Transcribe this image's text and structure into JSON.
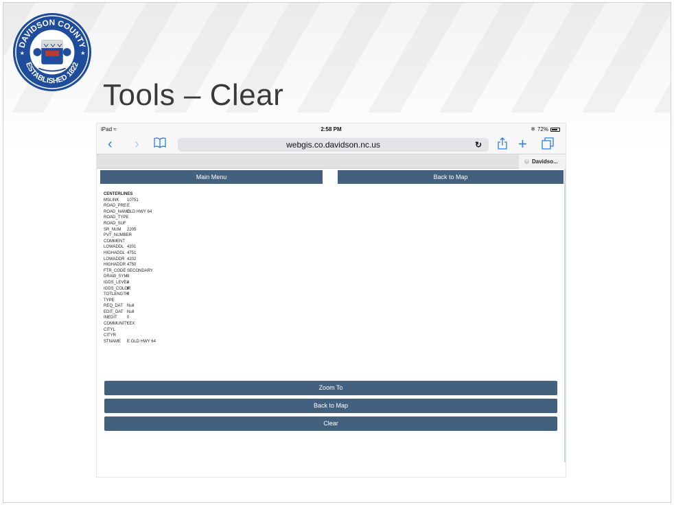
{
  "slide": {
    "title": "Tools – Clear",
    "seal_text_top": "DAVIDSON COUNTY",
    "seal_text_bottom": "ESTABLISHED 1822"
  },
  "status_bar": {
    "device": "iPad",
    "time": "2:58 PM",
    "battery": "72%"
  },
  "browser": {
    "url": "webgis.co.davidson.nc.us",
    "tab_label": "Davidso..."
  },
  "top_buttons": {
    "main_menu": "Main Menu",
    "back_to_map": "Back to Map"
  },
  "attributes": {
    "heading": "CENTERLINES",
    "rows": [
      {
        "key": "MSLINK",
        "value": "10751"
      },
      {
        "key": "ROAD_PRE",
        "value": "E"
      },
      {
        "key": "ROAD_NAME",
        "value": "OLD HWY 64"
      },
      {
        "key": "ROAD_TYPE",
        "value": ""
      },
      {
        "key": "ROAD_SUF",
        "value": ""
      },
      {
        "key": "SR_NUM",
        "value": "2205"
      },
      {
        "key": "PVT_NUMBER",
        "value": ""
      },
      {
        "key": "COMMENT",
        "value": ""
      },
      {
        "key": "LOWADDL",
        "value": "4201"
      },
      {
        "key": "HIGHADDL",
        "value": "4751"
      },
      {
        "key": "LOWADDR",
        "value": "4202"
      },
      {
        "key": "HIGHADDR",
        "value": "4750"
      },
      {
        "key": "FTR_CODE",
        "value": "SECONDARY"
      },
      {
        "key": "DRAW_SYM",
        "value": "8"
      },
      {
        "key": "IGDS_LEVEL",
        "value": "4"
      },
      {
        "key": "IGDS_COLOR",
        "value": "6"
      },
      {
        "key": "TOTLENGTH",
        "value": "0"
      },
      {
        "key": "TYPE",
        "value": ""
      },
      {
        "key": "REQ_DAT",
        "value": "Null"
      },
      {
        "key": "EDIT_DAT",
        "value": "Null"
      },
      {
        "key": "INEDIT",
        "value": "0"
      },
      {
        "key": "COMMUNITY",
        "value": "LEX"
      },
      {
        "key": "CITYL",
        "value": ""
      },
      {
        "key": "CITYR",
        "value": ""
      },
      {
        "key": "STNAME",
        "value": "E OLD HWY 64"
      }
    ]
  },
  "bottom_buttons": {
    "zoom_to": "Zoom To",
    "back_to_map": "Back to Map",
    "clear": "Clear"
  },
  "colors": {
    "button_blue": "#44607f",
    "link_blue": "#2a7bf3",
    "seal_blue": "#1f4d9b"
  },
  "icons": [
    "back-chevron-icon",
    "forward-chevron-icon",
    "bookmarks-icon",
    "reload-icon",
    "share-icon",
    "add-tab-icon",
    "tabs-icon",
    "wifi-icon",
    "bluetooth-icon",
    "battery-icon",
    "tab-close-icon"
  ]
}
